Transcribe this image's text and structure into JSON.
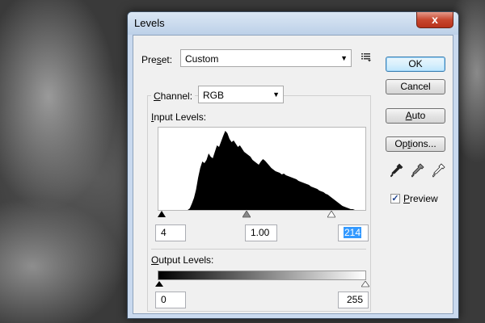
{
  "window": {
    "title": "Levels",
    "close_glyph": "x"
  },
  "preset": {
    "label_prefix": "Pre",
    "label_underline": "s",
    "label_suffix": "et:",
    "value": "Custom",
    "menu_icon": "list-menu-icon"
  },
  "buttons": {
    "ok": "OK",
    "cancel": "Cancel",
    "auto_u": "A",
    "auto_rest": "uto",
    "options_pre": "Op",
    "options_u": "t",
    "options_rest": "ions..."
  },
  "channel": {
    "label_u": "C",
    "label_rest": "hannel:",
    "value": "RGB"
  },
  "input_levels": {
    "label_u": "I",
    "label_rest": "nput Levels:",
    "black": "4",
    "gamma": "1.00",
    "white": "214"
  },
  "output_levels": {
    "label_u": "O",
    "label_rest": "utput Levels:",
    "black": "0",
    "white": "255"
  },
  "preview": {
    "label_u": "P",
    "label_rest": "review",
    "checked": true
  },
  "eyedroppers": [
    "black-point-eyedropper-icon",
    "gray-point-eyedropper-icon",
    "white-point-eyedropper-icon"
  ],
  "histogram": [
    0,
    0,
    0,
    0,
    0,
    0,
    0,
    0,
    0,
    0,
    0,
    0,
    0,
    0,
    0,
    2,
    8,
    15,
    25,
    40,
    52,
    60,
    58,
    62,
    70,
    66,
    64,
    72,
    80,
    78,
    85,
    92,
    98,
    95,
    88,
    84,
    86,
    82,
    78,
    80,
    76,
    72,
    70,
    68,
    66,
    62,
    60,
    58,
    56,
    60,
    63,
    61,
    58,
    55,
    52,
    50,
    48,
    47,
    46,
    44,
    45,
    43,
    42,
    41,
    40,
    39,
    38,
    36,
    35,
    34,
    33,
    32,
    31,
    29,
    28,
    27,
    26,
    24,
    23,
    22,
    20,
    19,
    17,
    15,
    13,
    11,
    9,
    7,
    5,
    4,
    3,
    2,
    1,
    1,
    0,
    0,
    0,
    0,
    0,
    0
  ],
  "colors": {
    "title_bar": "#bcd0e8",
    "close": "#c8472f",
    "selection": "#3399ff"
  }
}
